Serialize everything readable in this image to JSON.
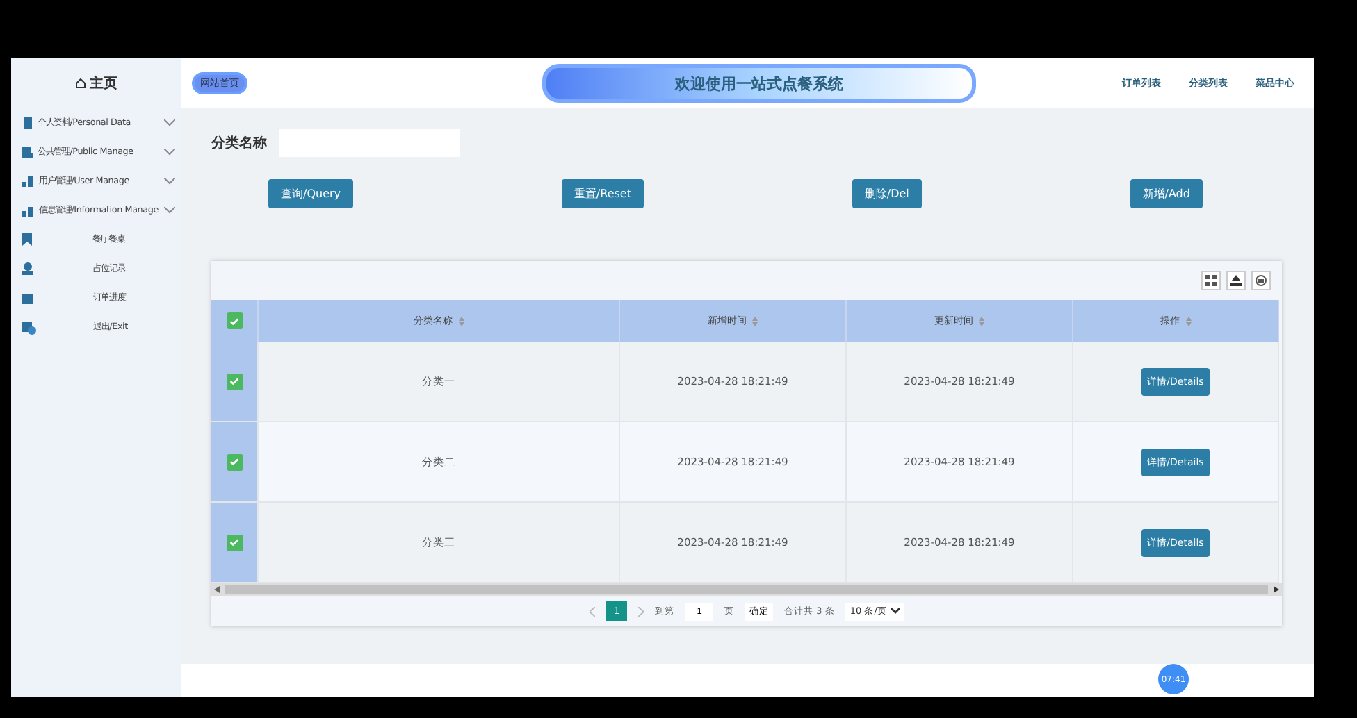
{
  "sidebar": {
    "home": "主页",
    "items": [
      {
        "kind": "group",
        "label": "个人资料/Personal Data",
        "expanded": false
      },
      {
        "kind": "group",
        "label": "公共管理/Public Manage",
        "expanded": false
      },
      {
        "kind": "group",
        "label": "用户管理/User Manage",
        "expanded": false
      },
      {
        "kind": "group",
        "label": "信息管理/Information Manage",
        "expanded": false
      },
      {
        "kind": "link",
        "label": "餐厅餐桌"
      },
      {
        "kind": "link",
        "label": "占位记录"
      },
      {
        "kind": "link",
        "label": "订单进度"
      },
      {
        "kind": "link",
        "label": "退出/Exit"
      }
    ]
  },
  "header": {
    "home_link": "网站首页",
    "title": "欢迎使用一站式点餐系统",
    "nav": [
      "订单列表",
      "分类列表",
      "菜品中心"
    ]
  },
  "filter": {
    "label": "分类名称"
  },
  "buttons": [
    "查询/Query",
    "重置/Reset",
    "删除/Del",
    "新增/Add"
  ],
  "table": {
    "all_checked": true,
    "columns": [
      "分类名称",
      "新增时间",
      "更新时间",
      "操作"
    ],
    "rows": [
      {
        "checked": true,
        "name": "分类一",
        "created": "2023-04-28 18:21:49",
        "updated": "2023-04-28 18:21:49",
        "action": "详情/Details"
      },
      {
        "checked": true,
        "name": "分类二",
        "created": "2023-04-28 18:21:49",
        "updated": "2023-04-28 18:21:49",
        "action": "详情/Details"
      },
      {
        "checked": true,
        "name": "分类三",
        "created": "2023-04-28 18:21:49",
        "updated": "2023-04-28 18:21:49",
        "action": "详情/Details"
      }
    ]
  },
  "pagination": {
    "pages": [
      {
        "label": "1",
        "selected": true
      }
    ],
    "goto_label": "到第",
    "goto_value": "1",
    "page_unit": "页",
    "confirm": "确定",
    "total": "合计共 3 条",
    "page_size": "10 条/页"
  },
  "clock_badge": "07:41"
}
